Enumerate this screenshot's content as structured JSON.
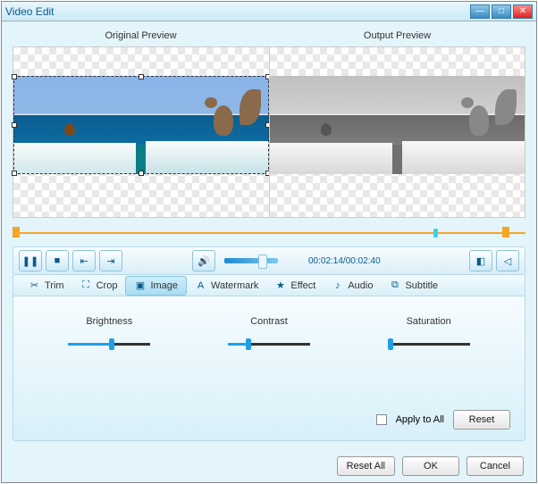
{
  "window": {
    "title": "Video Edit"
  },
  "preview": {
    "original_label": "Original Preview",
    "output_label": "Output Preview"
  },
  "playback": {
    "time": "00:02:14/00:02:40"
  },
  "tabs": [
    {
      "icon": "✂",
      "label": "Trim"
    },
    {
      "icon": "⛶",
      "label": "Crop"
    },
    {
      "icon": "▣",
      "label": "Image"
    },
    {
      "icon": "A",
      "label": "Watermark"
    },
    {
      "icon": "★",
      "label": "Effect"
    },
    {
      "icon": "♪",
      "label": "Audio"
    },
    {
      "icon": "⧉",
      "label": "Subtitle"
    }
  ],
  "sliders": {
    "brightness": {
      "label": "Brightness",
      "pct": 50
    },
    "contrast": {
      "label": "Contrast",
      "pct": 22
    },
    "saturation": {
      "label": "Saturation",
      "pct": 0
    }
  },
  "panel": {
    "apply_all": "Apply to All",
    "reset": "Reset"
  },
  "footer": {
    "reset_all": "Reset All",
    "ok": "OK",
    "cancel": "Cancel"
  }
}
